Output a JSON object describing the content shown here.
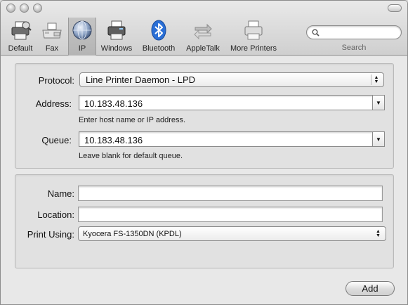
{
  "toolbar": {
    "items": [
      {
        "label": "Default",
        "icon": "default-printer-icon"
      },
      {
        "label": "Fax",
        "icon": "fax-icon"
      },
      {
        "label": "IP",
        "icon": "ip-globe-icon",
        "selected": true
      },
      {
        "label": "Windows",
        "icon": "windows-printer-icon"
      },
      {
        "label": "Bluetooth",
        "icon": "bluetooth-icon"
      },
      {
        "label": "AppleTalk",
        "icon": "appletalk-icon"
      },
      {
        "label": "More Printers",
        "icon": "more-printers-icon"
      }
    ],
    "search": {
      "label": "Search",
      "value": "",
      "icon": "magnifier-icon"
    }
  },
  "ip_settings": {
    "protocol_label": "Protocol:",
    "protocol_value": "Line Printer Daemon - LPD",
    "address_label": "Address:",
    "address_value": "10.183.48.136",
    "address_hint": "Enter host name or IP address.",
    "queue_label": "Queue:",
    "queue_value": "10.183.48.136",
    "queue_hint": "Leave blank for default queue."
  },
  "printer_info": {
    "name_label": "Name:",
    "name_value": "",
    "location_label": "Location:",
    "location_value": "",
    "print_using_label": "Print Using:",
    "print_using_value": "Kyocera FS-1350DN (KPDL)"
  },
  "actions": {
    "add_label": "Add"
  },
  "colors": {
    "bluetooth": "#2a6fd6",
    "window_bg": "#e8e8e8"
  }
}
